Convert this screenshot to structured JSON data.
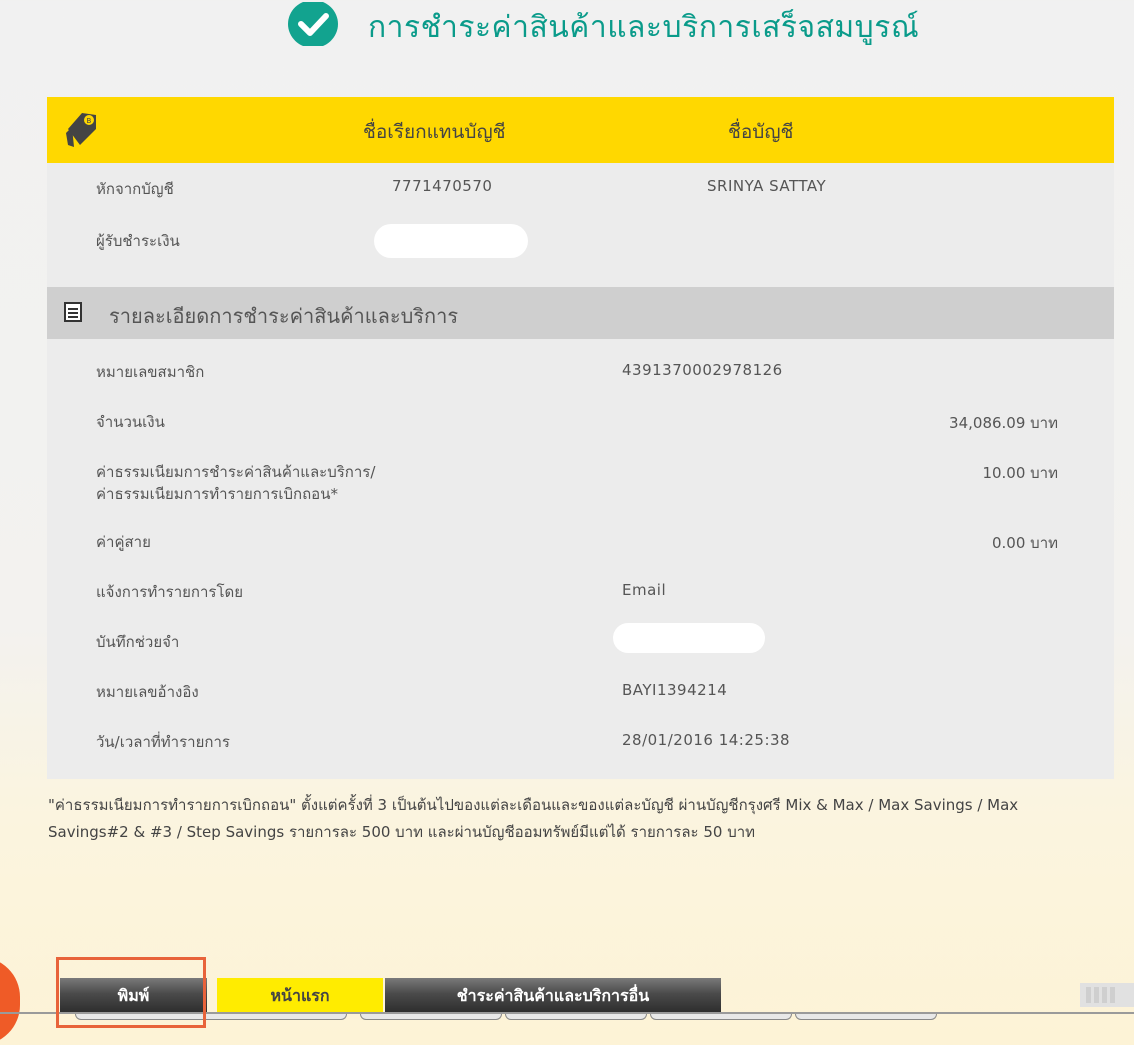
{
  "header": {
    "title": "การชำระค่าสินค้าและบริการเสร็จสมบูรณ์"
  },
  "account_header": {
    "nickname_col": "ชื่อเรียกแทนบัญชี",
    "name_col": "ชื่อบัญชี"
  },
  "from_account": {
    "label": "หักจากบัญชี",
    "number": "7771470570",
    "name": "SRINYA SATTAY"
  },
  "payee": {
    "label": "ผู้รับชำระเงิน"
  },
  "details": {
    "title": "รายละเอียดการชำระค่าสินค้าและบริการ",
    "rows": [
      {
        "label": "หมายเลขสมาชิก",
        "value": "4391370002978126"
      },
      {
        "label": "จำนวนเงิน",
        "amount": "34,086.09 บาท"
      },
      {
        "label_line1": "ค่าธรรมเนียมการชำระค่าสินค้าและบริการ/",
        "label_line2": "ค่าธรรมเนียมการทำรายการเบิกถอน*",
        "amount": "10.00 บาท"
      },
      {
        "label": "ค่าคู่สาย",
        "amount": "0.00 บาท"
      },
      {
        "label": "แจ้งการทำรายการโดย",
        "value": "Email"
      },
      {
        "label": "บันทึกช่วยจำ"
      },
      {
        "label": "หมายเลขอ้างอิง",
        "value": "BAYI1394214"
      },
      {
        "label": "วัน/เวลาที่ทำรายการ",
        "value": "28/01/2016 14:25:38"
      }
    ]
  },
  "note": "\"ค่าธรรมเนียมการทำรายการเบิกถอน\" ตั้งแต่ครั้งที่ 3 เป็นต้นไปของแต่ละเดือนและของแต่ละบัญชี ผ่านบัญชีกรุงศรี Mix & Max / Max Savings / Max Savings#2 & #3 / Step Savings รายการละ 500 บาท และผ่านบัญชีออมทรัพย์มีแต่ได้ รายการละ 50 บาท",
  "buttons": {
    "print": "พิมพ์",
    "home": "หน้าแรก",
    "other": "ชำระค่าสินค้าและบริการอื่น"
  },
  "colors": {
    "title": "#0a9b8a",
    "yellow": "#ffd800",
    "highlight": "#e8633a"
  }
}
